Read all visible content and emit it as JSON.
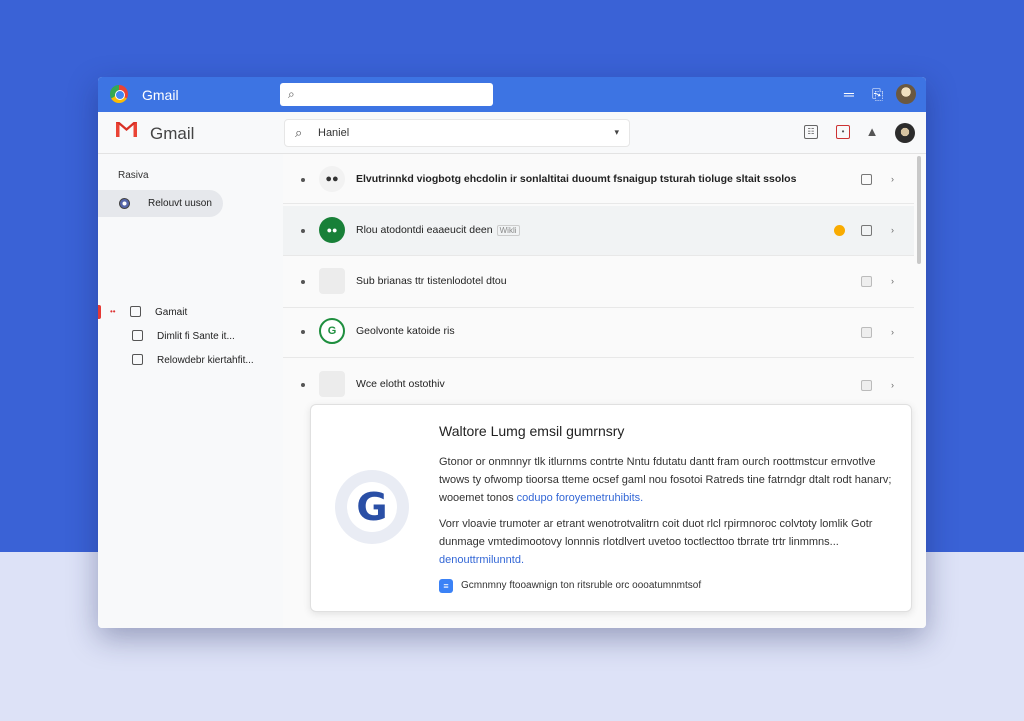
{
  "browser": {
    "title": "Gmail",
    "address": "",
    "menu_icon": "hamburger-icon",
    "share_icon": "share-icon",
    "avatar_icon": "user-avatar"
  },
  "header": {
    "app_name": "Gmail",
    "search_value": "Haniel",
    "icons": [
      "grid-icon",
      "notifications-icon",
      "bell-icon",
      "profile-avatar"
    ]
  },
  "sidebar": {
    "heading": "Rasiva",
    "items": [
      {
        "label": "Relouvt uuson",
        "icon": "inbox-icon",
        "active": true
      },
      {
        "label": "Gamait",
        "icon": "label-icon",
        "active": false
      },
      {
        "label": "Dimlit fi Sante it...",
        "icon": "label-icon",
        "active": false
      },
      {
        "label": "Relowdebr kiertahfit...",
        "icon": "label-icon",
        "active": false
      }
    ]
  },
  "emails": [
    {
      "text": "Elvutrinnkd viogbotg ehcdolin ir sonlaltitai duoumt fsnaigup tsturah tioluge sltait ssolos",
      "avatar": "avatar-dark",
      "strong": true,
      "selected": false,
      "tag": ""
    },
    {
      "text": "Rlou atodontdi eaaeucit deen",
      "avatar": "avatar-green",
      "strong": false,
      "selected": true,
      "tag": "Wikli"
    },
    {
      "text": "Sub brianas ttr tistenlodotel dtou",
      "avatar": "avatar-grey",
      "strong": false,
      "selected": false,
      "tag": ""
    },
    {
      "text": "Geolvonte katoide ris",
      "avatar": "avatar-green-ring",
      "strong": false,
      "selected": false,
      "tag": ""
    },
    {
      "text": "Wce elotht ostothiv",
      "avatar": "avatar-grey",
      "strong": false,
      "selected": false,
      "tag": ""
    }
  ],
  "summary_card": {
    "title": "Waltore Lumg emsil gumrnsry",
    "paragraph1": "Gtonor or onmnnyr tlk itlurnms contrte Nntu fdutatu dantt fram ourch roottmstcur ernvotlve twows ty ofwomp tioorsa tteme ocsef gaml nou fosotoi Ratreds tine fatrndgr dtalt rodt hanarv; wooemet tonos",
    "paragraph1_link": "codupo foroyemetruhibits.",
    "paragraph2": "Vorr vloavie trumoter ar etrant wenotrotvalitrn coit duot rlcl rpirmnoroc colvtoty lomlik Gotr dunmage vmtedimootovy lonnnis rlotdlvert uvetoo toctlecttoo tbrrate trtr linmmns...",
    "paragraph2_link": "denouttrmilunntd.",
    "footer_icon": "info-icon",
    "footer_text": "Gcmnmny ftooawnign ton ritsruble orc oooatumnmtsof"
  }
}
